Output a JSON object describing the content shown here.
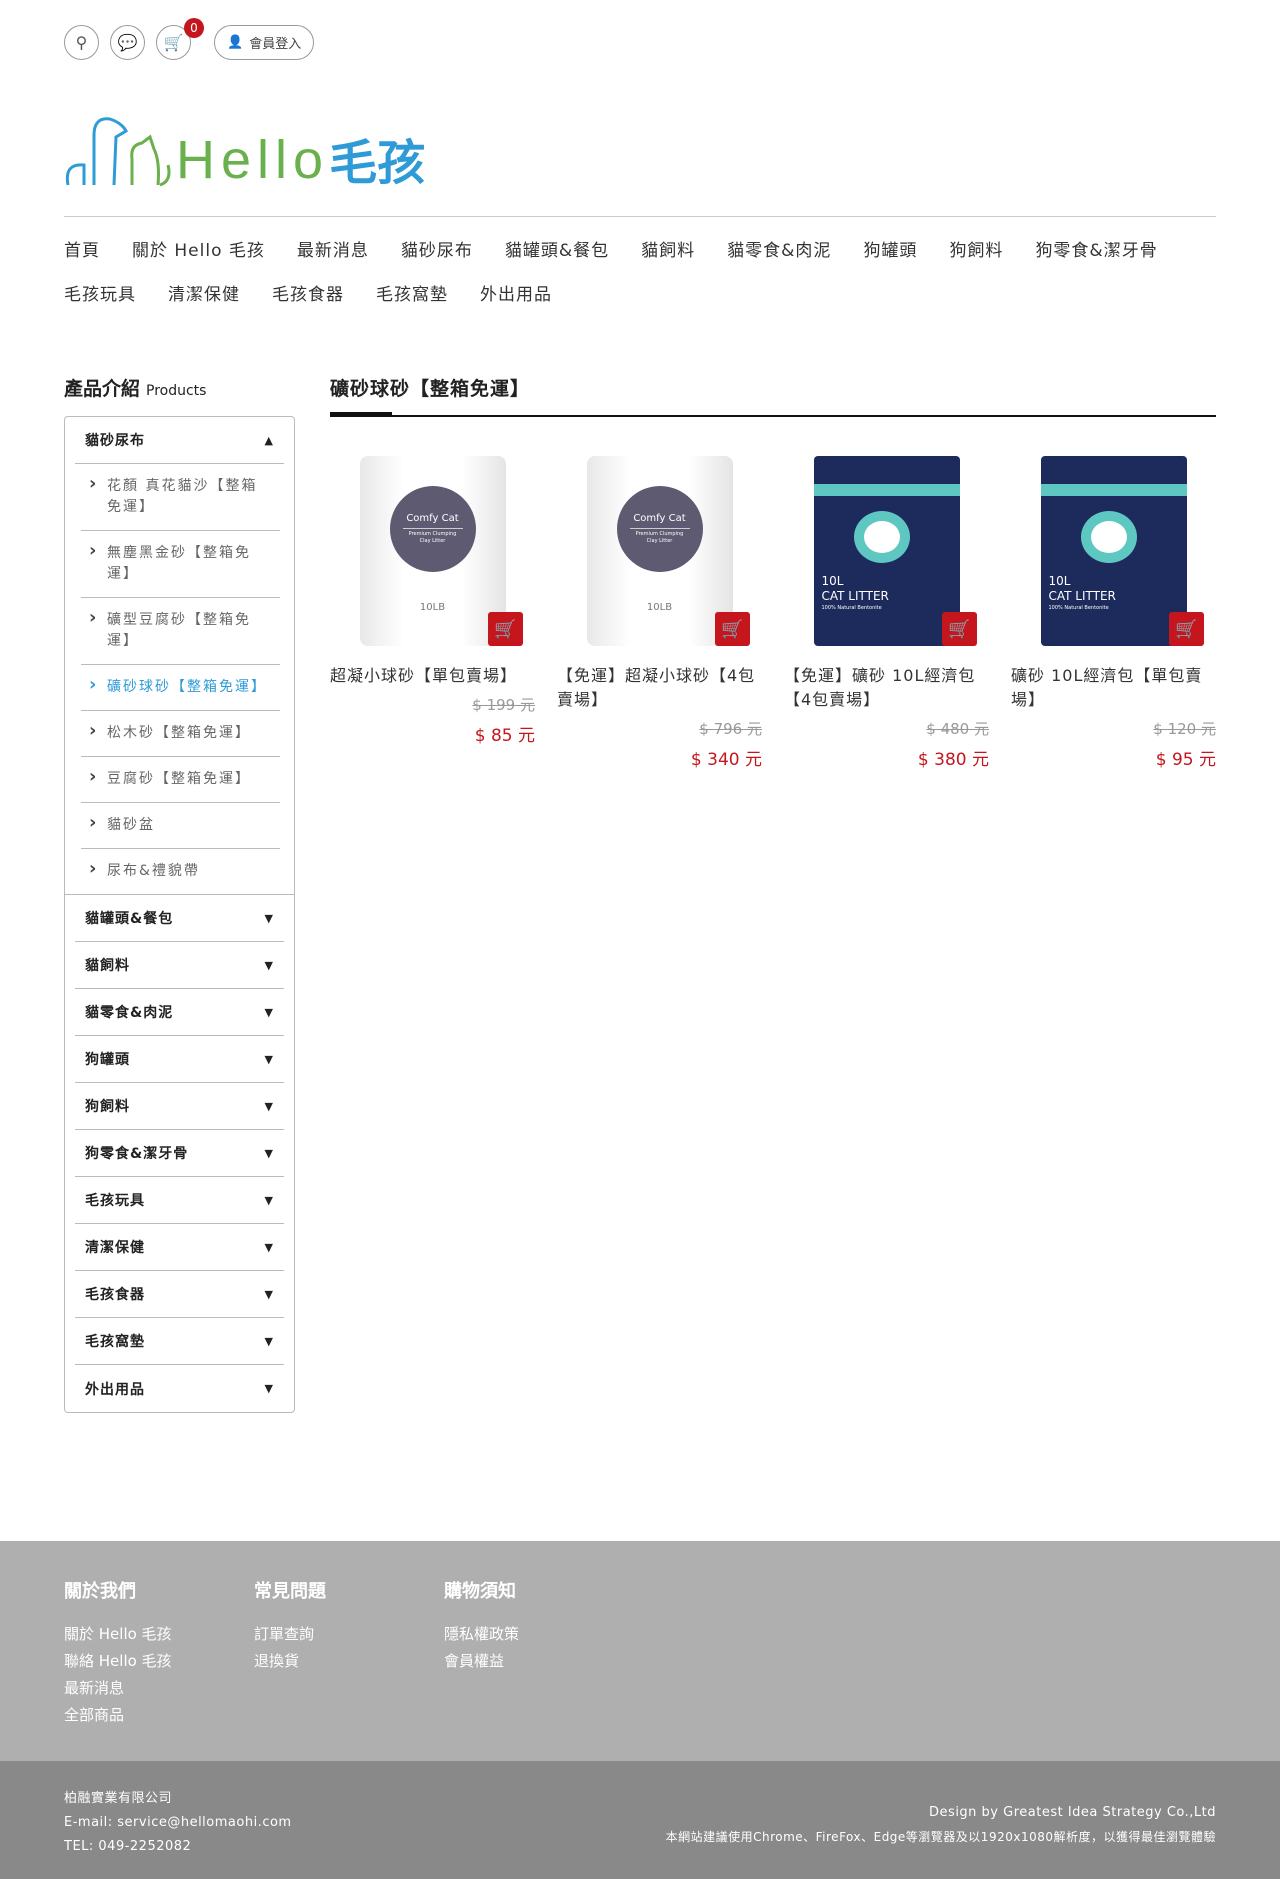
{
  "header": {
    "cart_count": "0",
    "login_label": "會員登入",
    "logo_text_en": "Hello",
    "logo_text_zh": "毛孩"
  },
  "nav": [
    "首頁",
    "關於 Hello 毛孩",
    "最新消息",
    "貓砂尿布",
    "貓罐頭&餐包",
    "貓飼料",
    "貓零食&肉泥",
    "狗罐頭",
    "狗飼料",
    "狗零食&潔牙骨",
    "毛孩玩具",
    "清潔保健",
    "毛孩食器",
    "毛孩窩墊",
    "外出用品"
  ],
  "sidebar": {
    "title": "產品介紹",
    "title_en": "Products",
    "open_category": "貓砂尿布",
    "subitems": [
      "花顏 真花貓沙【整箱免運】",
      "無塵黑金砂【整箱免運】",
      "礦型豆腐砂【整箱免運】",
      "礦砂球砂【整箱免運】",
      "松木砂【整箱免運】",
      "豆腐砂【整箱免運】",
      "貓砂盆",
      "尿布&禮貌帶"
    ],
    "active_subitem": "礦砂球砂【整箱免運】",
    "categories": [
      "貓罐頭&餐包",
      "貓飼料",
      "貓零食&肉泥",
      "狗罐頭",
      "狗飼料",
      "狗零食&潔牙骨",
      "毛孩玩具",
      "清潔保健",
      "毛孩食器",
      "毛孩窩墊",
      "外出用品"
    ]
  },
  "main": {
    "title": "礦砂球砂【整箱免運】",
    "products": [
      {
        "name": "超凝小球砂【單包賣場】",
        "old_price": "$ 199 元",
        "price": "$ 85 元",
        "image": "Comfy Cat 10LB white bag"
      },
      {
        "name": "【免運】超凝小球砂【4包賣場】",
        "old_price": "$ 796 元",
        "price": "$ 340 元",
        "image": "Comfy Cat 10LB white bag"
      },
      {
        "name": "【免運】礦砂 10L經濟包【4包賣場】",
        "old_price": "$ 480 元",
        "price": "$ 380 元",
        "image": "10L CAT LITTER blue bag"
      },
      {
        "name": "礦砂 10L經濟包【單包賣場】",
        "old_price": "$ 120 元",
        "price": "$ 95 元",
        "image": "10L CAT LITTER blue bag"
      }
    ]
  },
  "footer": {
    "cols": [
      {
        "title": "關於我們",
        "links": [
          "關於 Hello 毛孩",
          "聯絡 Hello 毛孩",
          "最新消息",
          "全部商品"
        ]
      },
      {
        "title": "常見問題",
        "links": [
          "訂單查詢",
          "退換貨"
        ]
      },
      {
        "title": "購物須知",
        "links": [
          "隱私權政策",
          "會員權益"
        ]
      }
    ],
    "company": "柏融實業有限公司",
    "email": "E-mail: service@hellomaohi.com",
    "tel": "TEL: 049-2252082",
    "design": "Design by Greatest Idea Strategy Co.,Ltd",
    "browser_note": "本網站建議使用Chrome、FireFox、Edge等瀏覽器及以1920x1080解析度，以獲得最佳瀏覽體驗"
  },
  "colors": {
    "accent_red": "#c4161c",
    "link_blue": "#2e9bd6",
    "logo_green": "#6ab04c",
    "footer_light": "#afafaf",
    "footer_dark": "#898989"
  },
  "bag_texts": {
    "comfy": "Comfy Cat",
    "comfy_sub": "Premium Clumping Clay Litter",
    "comfy_wt": "10LB",
    "blue_l1": "10L",
    "blue_l2": "CAT LITTER",
    "blue_l3": "100% Natural Bentonite"
  }
}
